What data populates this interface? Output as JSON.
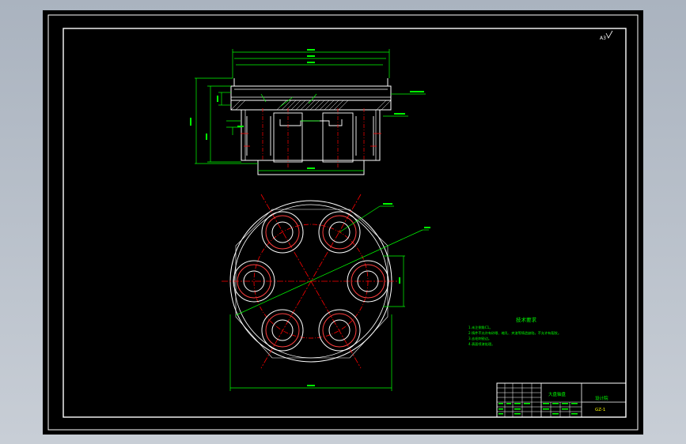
{
  "drawing": {
    "scale_mark": "A3",
    "tech_title": "技术要求",
    "tech_notes": [
      "1.未注倒角C1。",
      "2.铸件不允许有砂眼、缩孔、夹渣等铸造缺陷，不允许有裂纹。",
      "3.去毛刺锐边。",
      "4.表面喷漆处理。"
    ],
    "title_block": {
      "part_name": "大盘轴盘",
      "org": "设计院",
      "code": "GZ-1"
    }
  },
  "colors": {
    "sheet": "#000000",
    "outline": "#ffffff",
    "dimension": "#00ff00",
    "centerline": "#ff0000",
    "hatch": "#ffffff",
    "text_yellow": "#ffff00"
  }
}
